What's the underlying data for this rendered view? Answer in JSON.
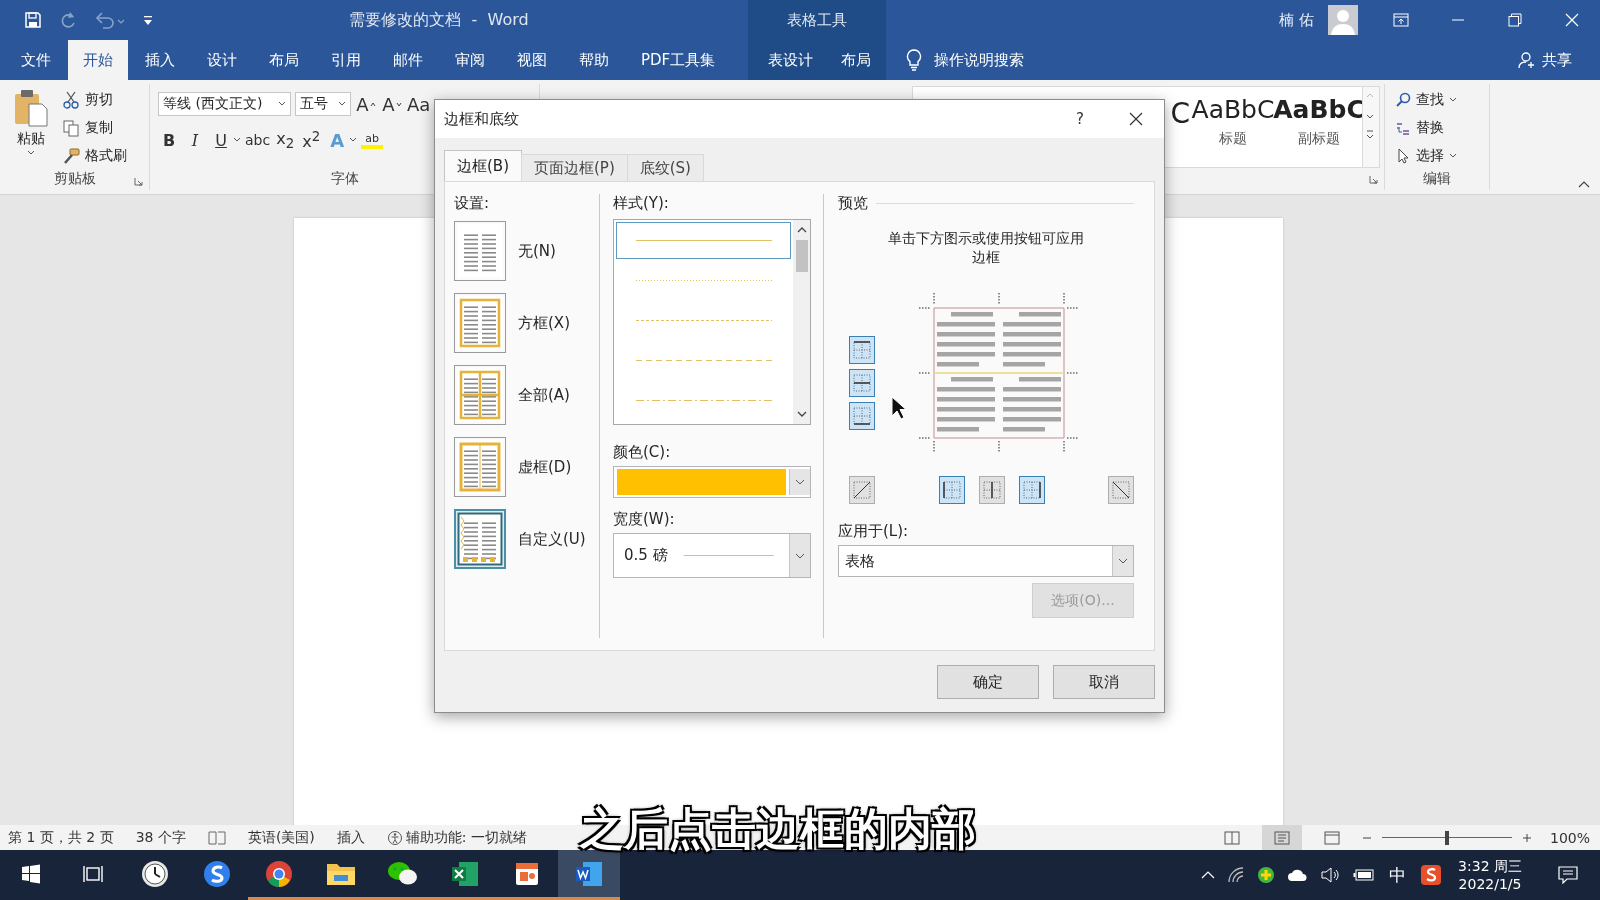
{
  "window": {
    "title": "需要修改的文档  -  Word",
    "context_group": "表格工具",
    "user": "楠 佑"
  },
  "quick_access": [
    {
      "kind": "save",
      "disabled": false
    },
    {
      "kind": "redo",
      "disabled": true
    },
    {
      "kind": "undo",
      "disabled": true
    },
    {
      "kind": "customize",
      "disabled": false
    }
  ],
  "ribbon_tabs": [
    {
      "label": "文件",
      "selected": false,
      "contextual": false
    },
    {
      "label": "开始",
      "selected": true,
      "contextual": false
    },
    {
      "label": "插入",
      "selected": false,
      "contextual": false
    },
    {
      "label": "设计",
      "selected": false,
      "contextual": false
    },
    {
      "label": "布局",
      "selected": false,
      "contextual": false
    },
    {
      "label": "引用",
      "selected": false,
      "contextual": false
    },
    {
      "label": "邮件",
      "selected": false,
      "contextual": false
    },
    {
      "label": "审阅",
      "selected": false,
      "contextual": false
    },
    {
      "label": "视图",
      "selected": false,
      "contextual": false
    },
    {
      "label": "帮助",
      "selected": false,
      "contextual": false
    },
    {
      "label": "PDF工具集",
      "selected": false,
      "contextual": false
    },
    {
      "label": "表设计",
      "selected": false,
      "contextual": true
    },
    {
      "label": "布局",
      "selected": false,
      "contextual": true
    }
  ],
  "tell_me": "操作说明搜索",
  "share": "共享",
  "clipboard": {
    "paste": "粘贴",
    "items": [
      {
        "kind": "cut",
        "label": "剪切"
      },
      {
        "kind": "copy",
        "label": "复制"
      },
      {
        "kind": "painter",
        "label": "格式刷"
      }
    ],
    "label": "剪贴板"
  },
  "font": {
    "name": "等线 (西文正文)",
    "size": "五号",
    "row1": [
      {
        "kind": "grow",
        "text": "A"
      },
      {
        "kind": "shrink",
        "text": "A"
      },
      {
        "kind": "case",
        "text": "Aa"
      }
    ],
    "row2": [
      {
        "kind": "bold",
        "text": "B",
        "menu": false
      },
      {
        "kind": "italic",
        "text": "I",
        "menu": false
      },
      {
        "kind": "underline",
        "text": "U",
        "menu": true
      },
      {
        "kind": "strike",
        "text": "abc",
        "menu": false
      },
      {
        "kind": "sub",
        "text": "x$_{2}$",
        "menu": false
      },
      {
        "kind": "sup",
        "text": "x$^{2}$",
        "menu": false
      },
      {
        "kind": "effects",
        "text": "A",
        "menu": true
      },
      {
        "kind": "highlight",
        "text": "ab",
        "menu": false
      }
    ],
    "label": "字体"
  },
  "styles": {
    "cut_sample": "C",
    "items": [
      {
        "sample": "AaBbC",
        "name": "标题",
        "bold": false
      },
      {
        "sample": "AaBbC",
        "name": "副标题",
        "bold": true
      }
    ]
  },
  "editing": {
    "items": [
      {
        "kind": "find",
        "label": "查找",
        "menu": true
      },
      {
        "kind": "replace",
        "label": "替换",
        "menu": false
      },
      {
        "kind": "select",
        "label": "选择",
        "menu": true
      }
    ],
    "label": "编辑"
  },
  "dialog": {
    "title": "边框和底纹",
    "help": "?",
    "tabs": [
      {
        "label": "边框(B)",
        "selected": true
      },
      {
        "label": "页面边框(P)",
        "selected": false
      },
      {
        "label": "底纹(S)",
        "selected": false
      }
    ],
    "settings": {
      "label": "设置:",
      "items": [
        {
          "kind": "none",
          "label": "无(N)",
          "selected": false
        },
        {
          "kind": "box",
          "label": "方框(X)",
          "selected": false
        },
        {
          "kind": "all",
          "label": "全部(A)",
          "selected": false
        },
        {
          "kind": "grid",
          "label": "虚框(D)",
          "selected": false
        },
        {
          "kind": "custom",
          "label": "自定义(U)",
          "selected": true
        }
      ]
    },
    "style": {
      "label": "样式(Y):",
      "lines": [
        {
          "kind": "solid",
          "selected": true
        },
        {
          "kind": "dotted",
          "selected": false
        },
        {
          "kind": "fine-dash",
          "selected": false
        },
        {
          "kind": "dashed",
          "selected": false
        },
        {
          "kind": "dash-dot",
          "selected": false
        }
      ]
    },
    "color": {
      "label": "颜色(C):",
      "color": "#ffc000"
    },
    "width": {
      "label": "宽度(W):",
      "value": "0.5 磅"
    },
    "preview": {
      "label": "预览",
      "hint": "单击下方图示或使用按钮可应用边框",
      "side_buttons": [
        {
          "kind": "top",
          "on": true
        },
        {
          "kind": "inside-h",
          "on": true
        },
        {
          "kind": "bottom",
          "on": true
        }
      ],
      "bottom_buttons": [
        {
          "kind": "diag-up",
          "on": false
        },
        {
          "kind": "left",
          "on": true
        },
        {
          "kind": "inside-v",
          "on": false
        },
        {
          "kind": "right",
          "on": true
        },
        {
          "kind": "diag-down",
          "on": false
        }
      ]
    },
    "apply_to": {
      "label": "应用于(L):",
      "value": "表格"
    },
    "options": {
      "label": "选项(O)...",
      "disabled": true
    },
    "ok": "确定",
    "cancel": "取消"
  },
  "status_bar": {
    "items": [
      {
        "kind": "text",
        "text": "第 1 页，共 2 页"
      },
      {
        "kind": "text",
        "text": "38 个字"
      },
      {
        "kind": "proofing"
      },
      {
        "kind": "text",
        "text": "英语(美国)"
      },
      {
        "kind": "text",
        "text": "插入"
      },
      {
        "kind": "accessibility",
        "text": "辅助功能: 一切就绪"
      }
    ],
    "views": [
      {
        "kind": "read",
        "selected": false
      },
      {
        "kind": "print",
        "selected": true
      },
      {
        "kind": "web",
        "selected": false
      }
    ],
    "zoom": {
      "level": 0.5,
      "value": "100%"
    }
  },
  "taskbar": {
    "apps": [
      {
        "kind": "start",
        "running": false,
        "active": false
      },
      {
        "kind": "taskview",
        "running": false,
        "active": false
      },
      {
        "kind": "clock",
        "running": false,
        "active": false
      },
      {
        "kind": "sogou",
        "running": false,
        "active": false
      },
      {
        "kind": "chrome",
        "running": true,
        "active": false
      },
      {
        "kind": "explorer",
        "running": true,
        "active": false
      },
      {
        "kind": "wechat",
        "running": true,
        "active": false
      },
      {
        "kind": "excel",
        "running": true,
        "active": false
      },
      {
        "kind": "slides",
        "running": true,
        "active": false
      },
      {
        "kind": "word",
        "running": true,
        "active": true
      }
    ],
    "tray": [
      {
        "kind": "chevron"
      },
      {
        "kind": "network"
      },
      {
        "kind": "plus"
      },
      {
        "kind": "cloud"
      },
      {
        "kind": "volume"
      },
      {
        "kind": "battery"
      }
    ],
    "ime": "中",
    "time": "3:32 周三",
    "date": "2022/1/5"
  },
  "caption": "之后点击边框的内部"
}
